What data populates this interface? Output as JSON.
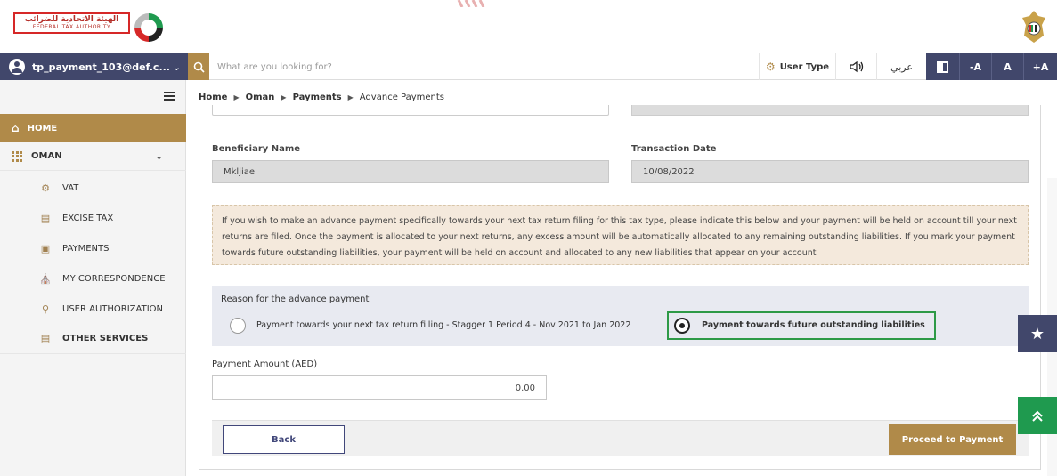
{
  "header": {
    "logo_arabic": "الهيئة الاتحادية للضرائب",
    "logo_english": "FEDERAL TAX AUTHORITY"
  },
  "navbar": {
    "user_email": "tp_payment_103@def.c...",
    "search_placeholder": "What are you looking for?",
    "user_type_label": "User Type",
    "arabic_label": "عربي",
    "font_decrease": "-A",
    "font_normal": "A",
    "font_increase": "+A"
  },
  "sidebar": {
    "home": "HOME",
    "oman": "OMAN",
    "items": [
      {
        "label": "VAT",
        "icon": "vat-icon"
      },
      {
        "label": "EXCISE TAX",
        "icon": "excise-icon"
      },
      {
        "label": "PAYMENTS",
        "icon": "payments-icon"
      },
      {
        "label": "MY CORRESPONDENCE",
        "icon": "bank-icon"
      },
      {
        "label": "USER AUTHORIZATION",
        "icon": "user-key-icon"
      }
    ],
    "other_services": "OTHER SERVICES"
  },
  "breadcrumb": {
    "home": "Home",
    "oman": "Oman",
    "payments": "Payments",
    "current": "Advance Payments"
  },
  "form": {
    "beneficiary_label": "Beneficiary Name",
    "beneficiary_value": "Mkljiae",
    "transaction_date_label": "Transaction Date",
    "transaction_date_value": "10/08/2022",
    "info_text": "If you wish to make an advance payment specifically towards your next tax return filing for this tax type, please indicate this below and your payment will be held on account till your next returns are filed. Once the payment is allocated to your next returns, any excess amount will be automatically allocated to any remaining outstanding liabilities. If you mark your payment towards future outstanding liabilities, your payment will be held on account and allocated to any new liabilities that appear on your account",
    "reason_title": "Reason for the advance payment",
    "option1": "Payment towards your next tax return filling - Stagger 1 Period 4 - Nov 2021 to Jan 2022",
    "option2": "Payment towards future outstanding liabilities",
    "amount_label": "Payment Amount (AED)",
    "amount_value": "0.00",
    "back_label": "Back",
    "proceed_label": "Proceed to Payment"
  },
  "colors": {
    "navy": "#41476b",
    "gold": "#b08a49",
    "green": "#1f9a4f"
  }
}
